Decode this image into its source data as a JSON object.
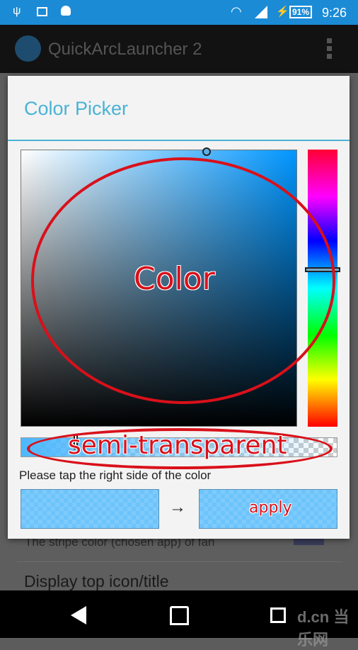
{
  "status_bar": {
    "battery": "91%",
    "time": "9:26",
    "icons": [
      "usb-icon",
      "image-icon",
      "android-icon",
      "wifi-icon",
      "signal-icon",
      "charging-icon",
      "battery-icon"
    ]
  },
  "app_bar": {
    "title": "QuickArcLauncher 2",
    "icons": [
      "app-logo-icon",
      "overflow-menu-icon"
    ]
  },
  "background": {
    "item_summary": "The stripe color (chosen app) of fan",
    "item_title": "Display top icon/title"
  },
  "dialog": {
    "title": "Color Picker",
    "accent": "#4ab3d6",
    "hue_color": "#0096ff",
    "selected_color": "#4db8ff",
    "alpha_level": 0.55,
    "hint": "Please tap the right side of the color",
    "arrow": "→"
  },
  "annotations": {
    "color": "Color",
    "alpha": "semi-transparent",
    "apply": "apply",
    "color_hex": "#d9101a"
  },
  "nav_bar": {
    "icons": [
      "back-icon",
      "home-icon",
      "recents-icon"
    ]
  },
  "watermark": "d.cn 当乐网"
}
